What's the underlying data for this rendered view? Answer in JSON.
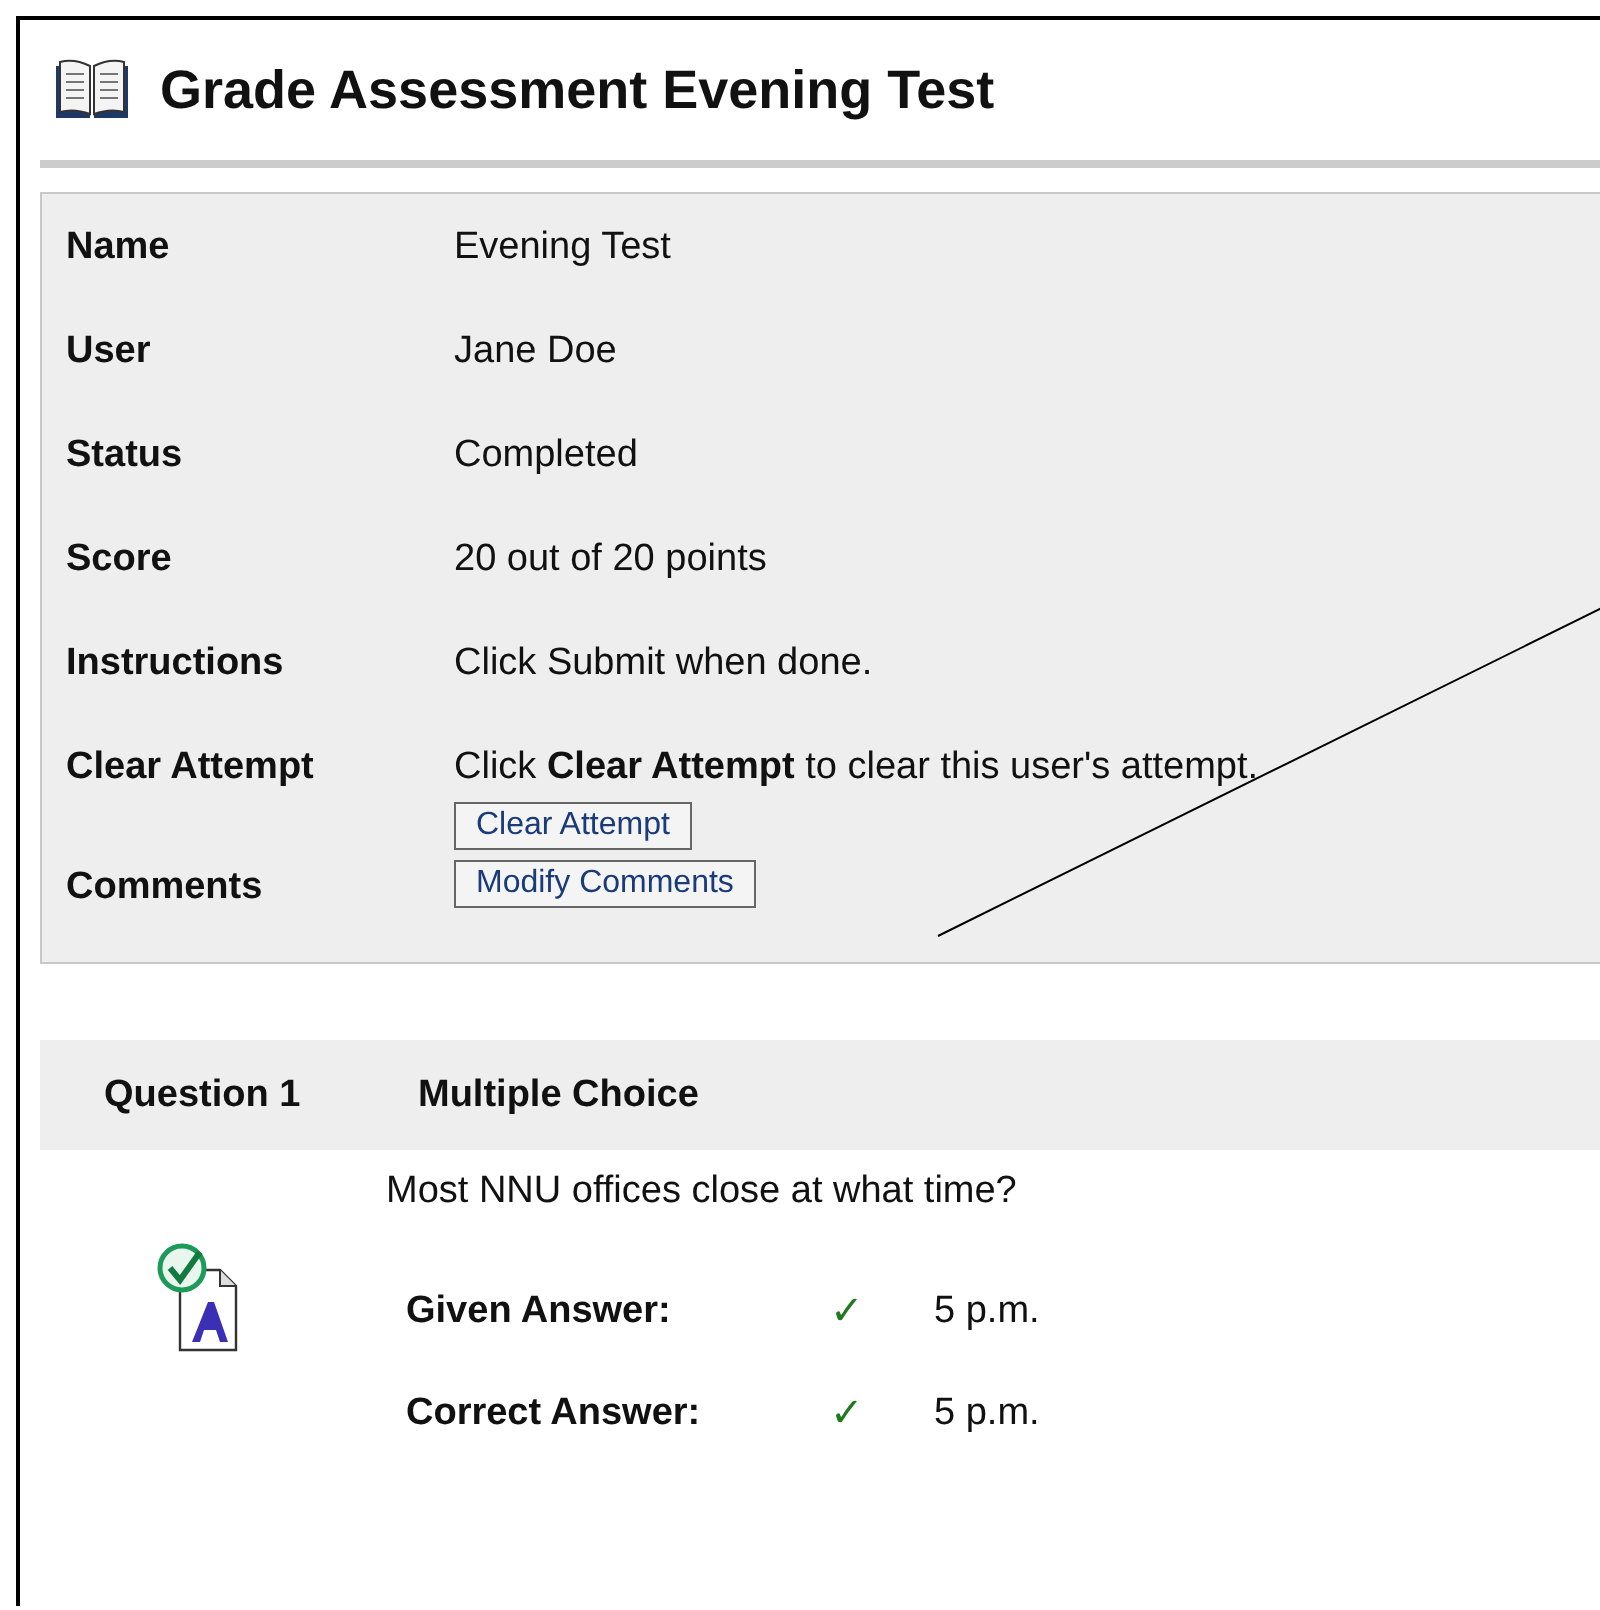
{
  "page_title": "Grade Assessment Evening Test",
  "details": [
    {
      "label": "Name",
      "value": "Evening Test"
    },
    {
      "label": "User",
      "value": "Jane Doe"
    },
    {
      "label": "Status",
      "value": "Completed"
    },
    {
      "label": "Score",
      "value": "20 out of 20 points"
    },
    {
      "label": "Instructions",
      "value": "Click Submit when done."
    },
    {
      "label": "Clear Attempt",
      "value": "Click **Clear Attempt** to clear this user's attempt.",
      "button": "Clear Attempt"
    },
    {
      "label": "Comments",
      "button": "Modify Comments"
    }
  ],
  "question": {
    "number": "Question 1",
    "type": "Multiple Choice",
    "text": "Most NNU offices close at what time?",
    "answers": [
      {
        "label": "Given Answer:",
        "mark": "✓",
        "value": "5 p.m."
      },
      {
        "label": "Correct Answer:",
        "mark": "✓",
        "value": "5 p.m."
      }
    ]
  }
}
